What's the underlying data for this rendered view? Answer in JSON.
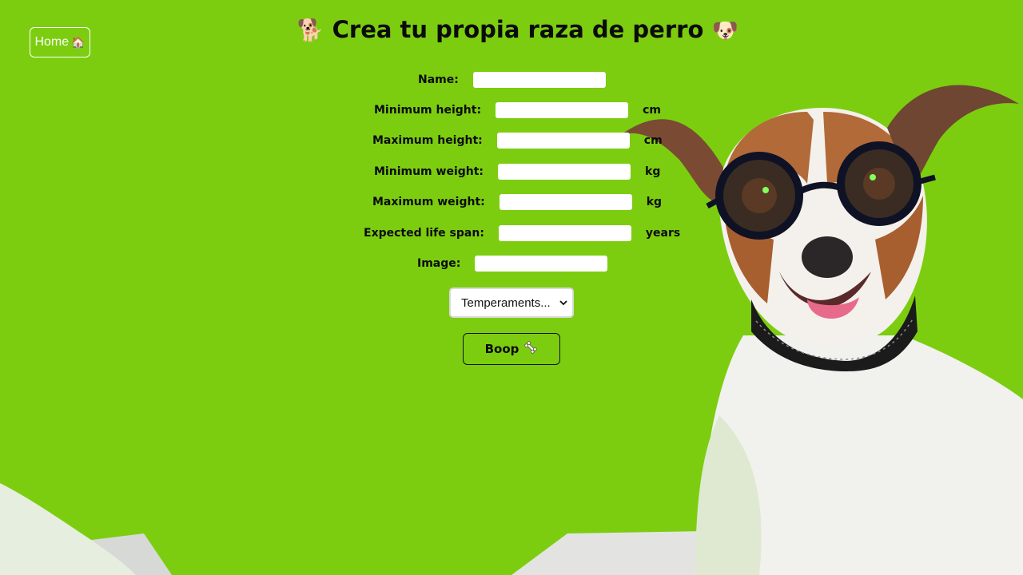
{
  "nav": {
    "home_label": "Home",
    "home_icon": "house-icon"
  },
  "header": {
    "title": "Crea tu propia raza de perro",
    "left_emoji": "🐕",
    "right_emoji": "🐶"
  },
  "form": {
    "fields": [
      {
        "label": "Name:",
        "value": "",
        "unit": ""
      },
      {
        "label": "Minimum height:",
        "value": "",
        "unit": "cm"
      },
      {
        "label": "Maximum height:",
        "value": "",
        "unit": "cm"
      },
      {
        "label": "Minimum weight:",
        "value": "",
        "unit": "kg"
      },
      {
        "label": "Maximum weight:",
        "value": "",
        "unit": "kg"
      },
      {
        "label": "Expected life span:",
        "value": "",
        "unit": "years"
      },
      {
        "label": "Image:",
        "value": "",
        "unit": ""
      }
    ],
    "temperaments_select": "Temperaments...",
    "submit_label": "Boop",
    "submit_icon": "bone-icon"
  },
  "colors": {
    "background": "#7ccd10",
    "text": "#0b0b0b",
    "field": "#ffffff"
  }
}
